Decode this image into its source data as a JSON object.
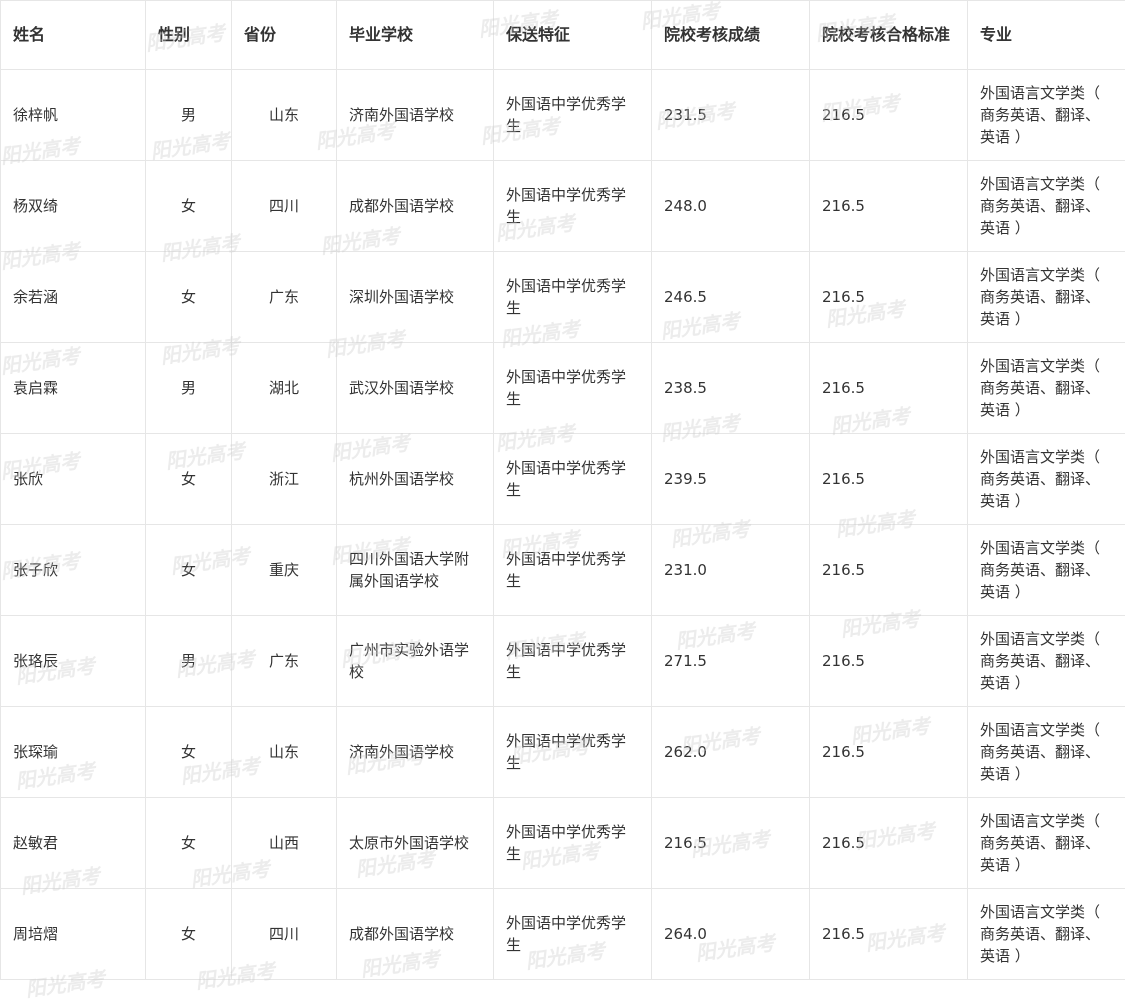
{
  "watermark": "阳光高考",
  "table": {
    "headers": [
      "姓名",
      "性别",
      "省份",
      "毕业学校",
      "保送特征",
      "院校考核成绩",
      "院校考核合格标准",
      "专业"
    ],
    "rows": [
      [
        "徐梓帆",
        "男",
        "山东",
        "济南外国语学校",
        "外国语中学优秀学生",
        "231.5",
        "216.5",
        "外国语言文学类（ 商务英语、翻译、英语 ）"
      ],
      [
        "杨双绮",
        "女",
        "四川",
        "成都外国语学校",
        "外国语中学优秀学生",
        "248.0",
        "216.5",
        "外国语言文学类（ 商务英语、翻译、英语 ）"
      ],
      [
        "余若涵",
        "女",
        "广东",
        "深圳外国语学校",
        "外国语中学优秀学生",
        "246.5",
        "216.5",
        "外国语言文学类（ 商务英语、翻译、英语 ）"
      ],
      [
        "袁启霖",
        "男",
        "湖北",
        "武汉外国语学校",
        "外国语中学优秀学生",
        "238.5",
        "216.5",
        "外国语言文学类（ 商务英语、翻译、英语 ）"
      ],
      [
        "张欣",
        "女",
        "浙江",
        "杭州外国语学校",
        "外国语中学优秀学生",
        "239.5",
        "216.5",
        "外国语言文学类（ 商务英语、翻译、英语 ）"
      ],
      [
        "张子欣",
        "女",
        "重庆",
        "四川外国语大学附属外国语学校",
        "外国语中学优秀学生",
        "231.0",
        "216.5",
        "外国语言文学类（ 商务英语、翻译、英语 ）"
      ],
      [
        "张珞辰",
        "男",
        "广东",
        "广州市实验外语学校",
        "外国语中学优秀学生",
        "271.5",
        "216.5",
        "外国语言文学类（ 商务英语、翻译、英语 ）"
      ],
      [
        "张琛瑜",
        "女",
        "山东",
        "济南外国语学校",
        "外国语中学优秀学生",
        "262.0",
        "216.5",
        "外国语言文学类（ 商务英语、翻译、英语 ）"
      ],
      [
        "赵敏君",
        "女",
        "山西",
        "太原市外国语学校",
        "外国语中学优秀学生",
        "216.5",
        "216.5",
        "外国语言文学类（ 商务英语、翻译、英语 ）"
      ],
      [
        "周培熠",
        "女",
        "四川",
        "成都外国语学校",
        "外国语中学优秀学生",
        "264.0",
        "216.5",
        "外国语言文学类（ 商务英语、翻译、英语 ）"
      ]
    ]
  }
}
